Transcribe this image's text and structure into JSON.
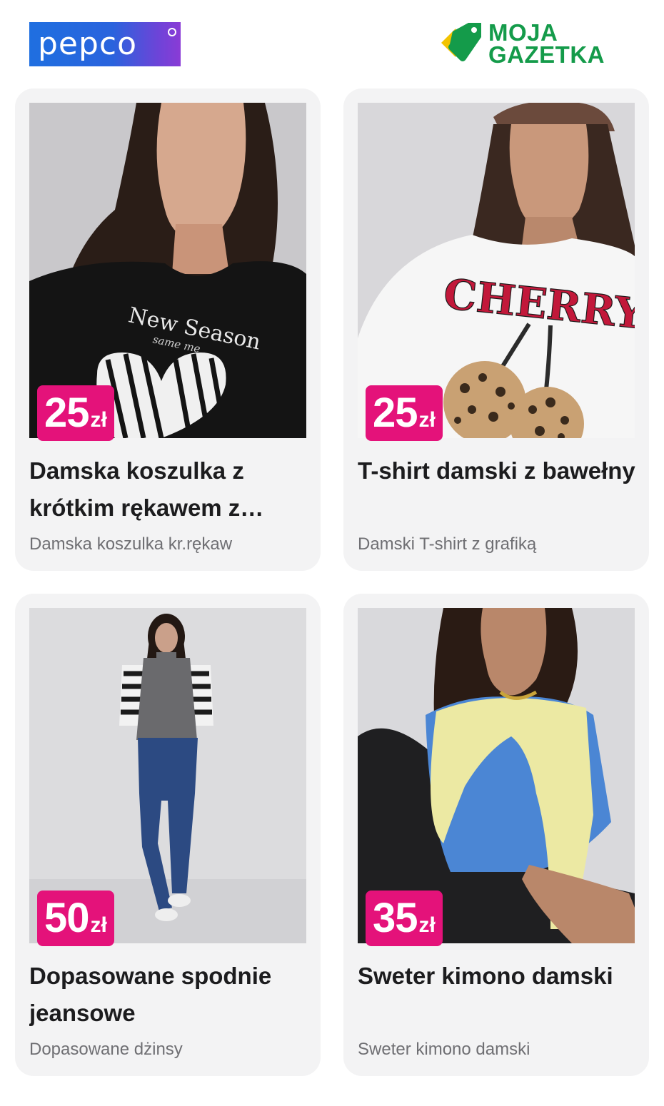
{
  "header": {
    "pepco_logo_text": "pepco",
    "moja_gazetka_line1": "MOJA",
    "moja_gazetka_line2": "GAZETKA"
  },
  "colors": {
    "price_badge": "#e4127a",
    "card_background": "#f3f3f4",
    "moja_green": "#149b4a",
    "pepco_blue": "#1f6fe0",
    "pepco_purple": "#8a3bd6"
  },
  "products": [
    {
      "price": "25",
      "currency": "zł",
      "title": "Damska koszulka z krótkim rękawem z…",
      "subtitle": "Damska koszulka kr.rękaw",
      "photo_text": "New Season",
      "photo_text_small": "same me",
      "image_icon": "black-tshirt-photo"
    },
    {
      "price": "25",
      "currency": "zł",
      "title": "T-shirt damski z bawełny",
      "subtitle": "Damski T-shirt z grafiką",
      "photo_text": "CHERRY",
      "image_icon": "white-tshirt-cherry-photo"
    },
    {
      "price": "50",
      "currency": "zł",
      "title": "Dopasowane spodnie jeansowe",
      "subtitle": "Dopasowane dżinsy",
      "image_icon": "jeans-model-photo"
    },
    {
      "price": "35",
      "currency": "zł",
      "title": "Sweter kimono damski",
      "subtitle": "Sweter kimono damski",
      "image_icon": "kimono-sweater-photo"
    }
  ]
}
